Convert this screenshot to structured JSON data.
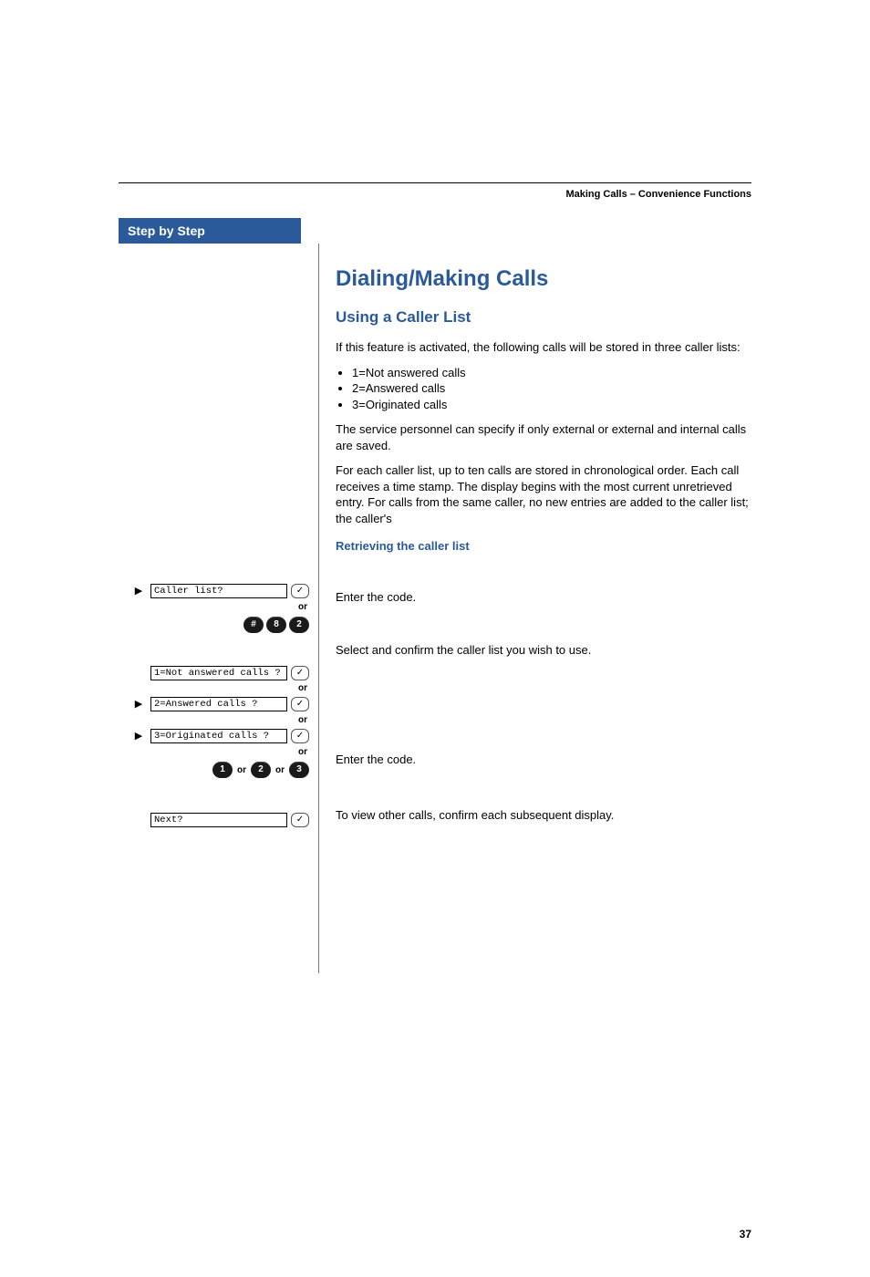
{
  "header": {
    "breadcrumb": "Making Calls – Convenience Functions"
  },
  "sidebar": {
    "title": "Step by Step"
  },
  "main": {
    "h1": "Dialing/Making Calls",
    "h2": "Using a Caller List",
    "intro": "If this feature is activated, the following calls will be stored in three caller lists:",
    "bullets": [
      "1=Not answered calls",
      "2=Answered calls",
      "3=Originated calls"
    ],
    "p_service": "The service personnel can specify if only external or external and internal calls are saved.",
    "p_storage": "For each caller list, up to ten calls are stored in chronological order. Each call receives a time stamp. The display begins with the most current unretrieved entry. For calls from the same caller, no new entries are added to the caller list; the caller's",
    "retrieve_heading": "Retrieving the caller list",
    "enter_code": "Enter the code.",
    "select_confirm": "Select and confirm the caller list you wish to use.",
    "to_view": "To view other calls, confirm each subsequent display."
  },
  "steps": {
    "caller_list": "Caller list?",
    "or": "or",
    "code_keys": [
      "#",
      "8",
      "2"
    ],
    "list1": "1=Not answered calls ?",
    "list2": "2=Answered calls ?",
    "list3": "3=Originated calls ?",
    "num_keys": [
      "1",
      "2",
      "3"
    ],
    "next": "Next?"
  },
  "page_number": "37"
}
